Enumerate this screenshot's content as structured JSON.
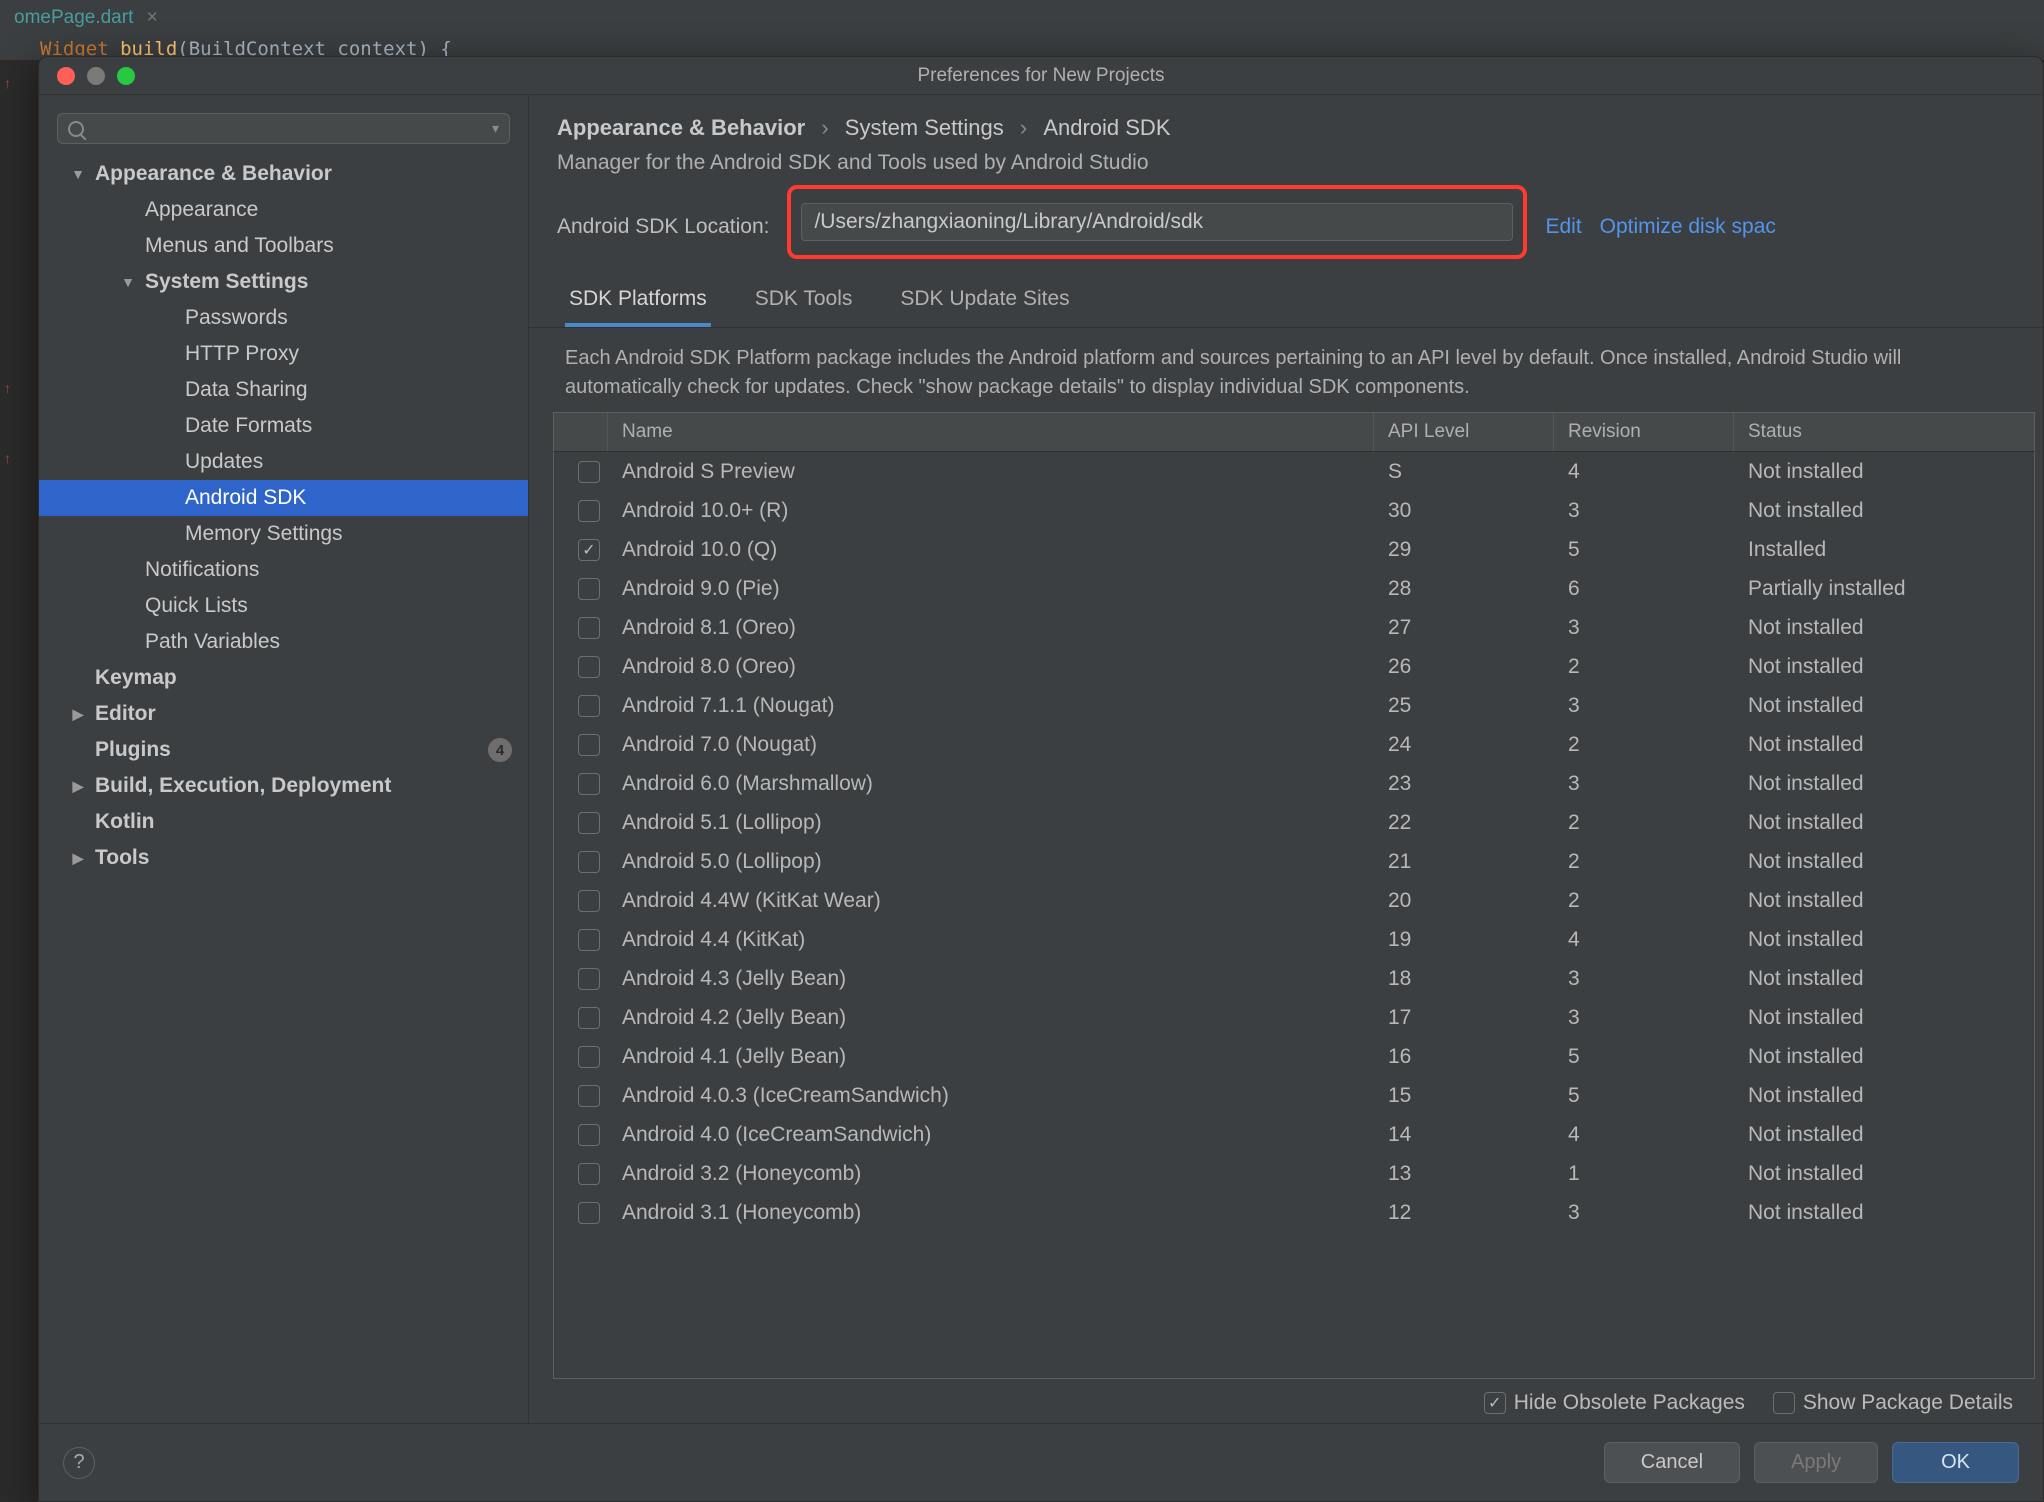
{
  "editor": {
    "tab": "omePage.dart",
    "code": "Widget build(BuildContext context) {"
  },
  "titlebar": {
    "title": "Preferences for New Projects"
  },
  "search": {
    "placeholder": ""
  },
  "sidebar": [
    {
      "label": "Appearance & Behavior",
      "indent": 0,
      "bold": true,
      "arrow": "down"
    },
    {
      "label": "Appearance",
      "indent": 1
    },
    {
      "label": "Menus and Toolbars",
      "indent": 1
    },
    {
      "label": "System Settings",
      "indent": 1,
      "bold": true,
      "arrow": "down"
    },
    {
      "label": "Passwords",
      "indent": 2
    },
    {
      "label": "HTTP Proxy",
      "indent": 2
    },
    {
      "label": "Data Sharing",
      "indent": 2
    },
    {
      "label": "Date Formats",
      "indent": 2
    },
    {
      "label": "Updates",
      "indent": 2
    },
    {
      "label": "Android SDK",
      "indent": 2,
      "selected": true
    },
    {
      "label": "Memory Settings",
      "indent": 2
    },
    {
      "label": "Notifications",
      "indent": 1
    },
    {
      "label": "Quick Lists",
      "indent": 1
    },
    {
      "label": "Path Variables",
      "indent": 1
    },
    {
      "label": "Keymap",
      "indent": 0,
      "bold": true
    },
    {
      "label": "Editor",
      "indent": 0,
      "bold": true,
      "arrow": "right"
    },
    {
      "label": "Plugins",
      "indent": 0,
      "bold": true,
      "badge": "4"
    },
    {
      "label": "Build, Execution, Deployment",
      "indent": 0,
      "bold": true,
      "arrow": "right"
    },
    {
      "label": "Kotlin",
      "indent": 0,
      "bold": true
    },
    {
      "label": "Tools",
      "indent": 0,
      "bold": true,
      "arrow": "right"
    }
  ],
  "breadcrumb": {
    "a": "Appearance & Behavior",
    "b": "System Settings",
    "c": "Android SDK"
  },
  "desc": "Manager for the Android SDK and Tools used by Android Studio",
  "location": {
    "label": "Android SDK Location:",
    "value": "/Users/zhangxiaoning/Library/Android/sdk",
    "edit": "Edit",
    "optimize": "Optimize disk spac"
  },
  "tabs": [
    "SDK Platforms",
    "SDK Tools",
    "SDK Update Sites"
  ],
  "hint": "Each Android SDK Platform package includes the Android platform and sources pertaining to an API level by default. Once installed, Android Studio will automatically check for updates. Check \"show package details\" to display individual SDK components.",
  "columns": {
    "name": "Name",
    "api": "API Level",
    "rev": "Revision",
    "status": "Status"
  },
  "rows": [
    {
      "name": "Android S Preview",
      "api": "S",
      "rev": "4",
      "status": "Not installed",
      "checked": false
    },
    {
      "name": "Android 10.0+ (R)",
      "api": "30",
      "rev": "3",
      "status": "Not installed",
      "checked": false
    },
    {
      "name": "Android 10.0 (Q)",
      "api": "29",
      "rev": "5",
      "status": "Installed",
      "checked": true
    },
    {
      "name": "Android 9.0 (Pie)",
      "api": "28",
      "rev": "6",
      "status": "Partially installed",
      "checked": false
    },
    {
      "name": "Android 8.1 (Oreo)",
      "api": "27",
      "rev": "3",
      "status": "Not installed",
      "checked": false
    },
    {
      "name": "Android 8.0 (Oreo)",
      "api": "26",
      "rev": "2",
      "status": "Not installed",
      "checked": false
    },
    {
      "name": "Android 7.1.1 (Nougat)",
      "api": "25",
      "rev": "3",
      "status": "Not installed",
      "checked": false
    },
    {
      "name": "Android 7.0 (Nougat)",
      "api": "24",
      "rev": "2",
      "status": "Not installed",
      "checked": false
    },
    {
      "name": "Android 6.0 (Marshmallow)",
      "api": "23",
      "rev": "3",
      "status": "Not installed",
      "checked": false
    },
    {
      "name": "Android 5.1 (Lollipop)",
      "api": "22",
      "rev": "2",
      "status": "Not installed",
      "checked": false
    },
    {
      "name": "Android 5.0 (Lollipop)",
      "api": "21",
      "rev": "2",
      "status": "Not installed",
      "checked": false
    },
    {
      "name": "Android 4.4W (KitKat Wear)",
      "api": "20",
      "rev": "2",
      "status": "Not installed",
      "checked": false
    },
    {
      "name": "Android 4.4 (KitKat)",
      "api": "19",
      "rev": "4",
      "status": "Not installed",
      "checked": false
    },
    {
      "name": "Android 4.3 (Jelly Bean)",
      "api": "18",
      "rev": "3",
      "status": "Not installed",
      "checked": false
    },
    {
      "name": "Android 4.2 (Jelly Bean)",
      "api": "17",
      "rev": "3",
      "status": "Not installed",
      "checked": false
    },
    {
      "name": "Android 4.1 (Jelly Bean)",
      "api": "16",
      "rev": "5",
      "status": "Not installed",
      "checked": false
    },
    {
      "name": "Android 4.0.3 (IceCreamSandwich)",
      "api": "15",
      "rev": "5",
      "status": "Not installed",
      "checked": false
    },
    {
      "name": "Android 4.0 (IceCreamSandwich)",
      "api": "14",
      "rev": "4",
      "status": "Not installed",
      "checked": false
    },
    {
      "name": "Android 3.2 (Honeycomb)",
      "api": "13",
      "rev": "1",
      "status": "Not installed",
      "checked": false
    },
    {
      "name": "Android 3.1 (Honeycomb)",
      "api": "12",
      "rev": "3",
      "status": "Not installed",
      "checked": false
    }
  ],
  "bottom": {
    "hide": "Hide Obsolete Packages",
    "details": "Show Package Details"
  },
  "footer": {
    "help": "?",
    "cancel": "Cancel",
    "apply": "Apply",
    "ok": "OK"
  }
}
